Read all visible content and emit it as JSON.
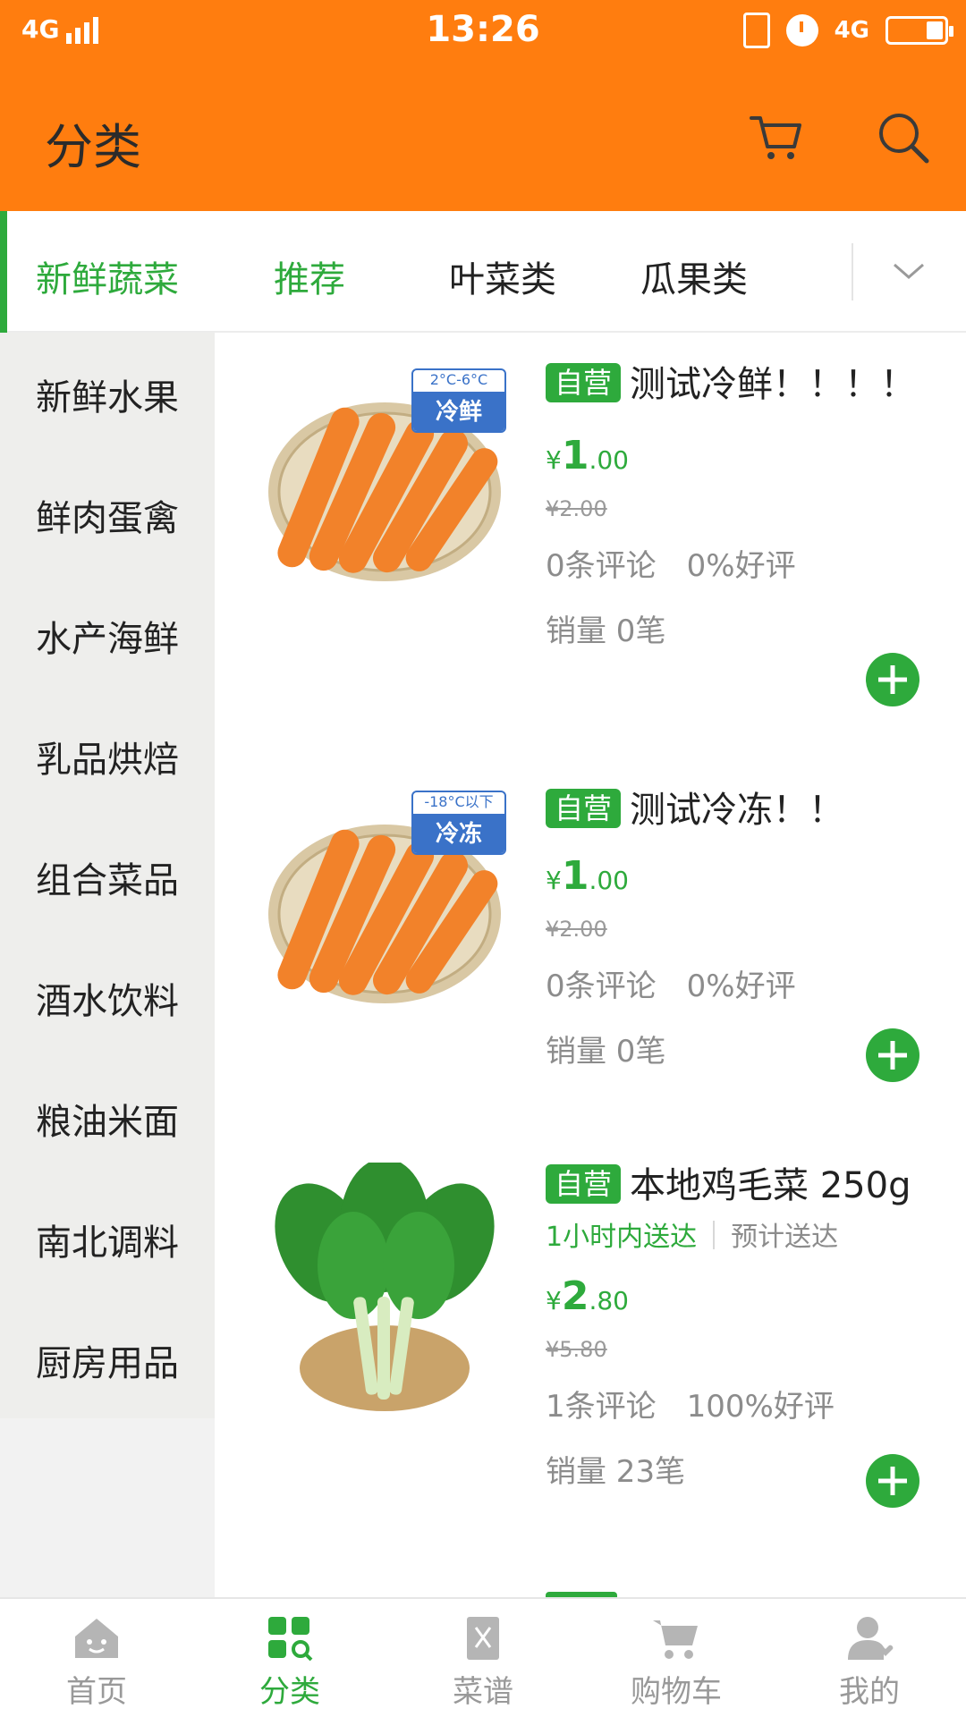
{
  "status_bar": {
    "network": "4G",
    "time": "13:26",
    "right_network": "4G"
  },
  "header": {
    "title": "分类",
    "bg_color": "#ff7d0f",
    "cart_icon": "cart-icon",
    "search_icon": "search-icon"
  },
  "tabs": [
    {
      "label": "新鲜蔬菜",
      "active": true
    },
    {
      "label": "推荐"
    },
    {
      "label": "叶菜类"
    },
    {
      "label": "瓜果类"
    }
  ],
  "sidebar": {
    "items": [
      {
        "label": "新鲜水果"
      },
      {
        "label": "鲜肉蛋禽"
      },
      {
        "label": "水产海鲜"
      },
      {
        "label": "乳品烘焙"
      },
      {
        "label": "组合菜品"
      },
      {
        "label": "酒水饮料"
      },
      {
        "label": "粮油米面"
      },
      {
        "label": "南北调料"
      },
      {
        "label": "厨房用品"
      }
    ]
  },
  "products": [
    {
      "tag": "自营",
      "name": "测试冷鲜！！！！",
      "badge_top": "2°C-6°C",
      "badge_bottom": "冷鲜",
      "price_symbol": "¥",
      "price_int": "1",
      "price_dec": ".00",
      "original_price": "¥2.00",
      "reviews": "0条评论",
      "rating": "0%好评",
      "sales": "销量 0笔"
    },
    {
      "tag": "自营",
      "name": "测试冷冻！！",
      "badge_top": "-18°C以下",
      "badge_bottom": "冷冻",
      "price_symbol": "¥",
      "price_int": "1",
      "price_dec": ".00",
      "original_price": "¥2.00",
      "reviews": "0条评论",
      "rating": "0%好评",
      "sales": "销量 0笔"
    },
    {
      "tag": "自营",
      "name": "本地鸡毛菜 250g",
      "delivery": "1小时内送达",
      "delivery_estimate": "预计送达",
      "price_symbol": "¥",
      "price_int": "2",
      "price_dec": ".80",
      "original_price": "¥5.80",
      "reviews": "1条评论",
      "rating": "100%好评",
      "sales": "销量 23笔"
    }
  ],
  "bottom_nav": [
    {
      "label": "首页",
      "icon": "home-icon"
    },
    {
      "label": "分类",
      "icon": "category-icon",
      "active": true
    },
    {
      "label": "菜谱",
      "icon": "recipe-icon"
    },
    {
      "label": "购物车",
      "icon": "cart-icon"
    },
    {
      "label": "我的",
      "icon": "profile-icon"
    }
  ],
  "colors": {
    "accent": "#2eaa3c",
    "header": "#ff7d0f",
    "muted": "#8c8c8c"
  }
}
